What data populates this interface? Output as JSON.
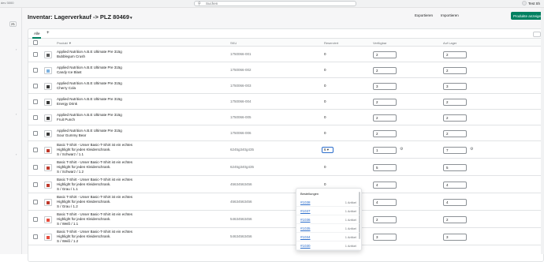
{
  "topbar": {
    "store": "dev 3000",
    "search_placeholder": "Suchen",
    "user_name": "Test Sh"
  },
  "sidebar": {
    "badge": "21"
  },
  "header": {
    "title": "Inventar: Lagerverkauf -> PLZ 80469",
    "title_chevron": "▾",
    "export_label": "Exportieren",
    "import_label": "Importieren",
    "primary_label": "Produkte anzeigen"
  },
  "tabs": {
    "all_label": "Alle",
    "add_label": "+"
  },
  "columns": {
    "product": "Produkt ▼",
    "sku": "SKU",
    "committed": "Reserviert",
    "available": "Verfügbar",
    "on_hand": "Auf Lager"
  },
  "rows": [
    {
      "name1": "Applied Nutrition A.B.E Ultimate Pre 315g",
      "name2": "Bubblegum Crush",
      "name3": "",
      "sku": "1750066-001",
      "committed": "0",
      "available": "2",
      "on_hand": "2",
      "thumb_color": "#5a5a5a"
    },
    {
      "name1": "Applied Nutrition A.B.E Ultimate Pre 315g",
      "name2": "Candy Ice Blast",
      "name3": "",
      "sku": "1750066-002",
      "committed": "0",
      "available": "2",
      "on_hand": "2",
      "thumb_color": "#7fb3e0"
    },
    {
      "name1": "Applied Nutrition A.B.E Ultimate Pre 315g",
      "name2": "Cherry Cola",
      "name3": "",
      "sku": "1750066-003",
      "committed": "0",
      "available": "3",
      "on_hand": "3",
      "thumb_color": "#3a3a3a"
    },
    {
      "name1": "Applied Nutrition A.B.E Ultimate Pre 315g",
      "name2": "Energy Drink",
      "name3": "",
      "sku": "1750066-004",
      "committed": "0",
      "available": "2",
      "on_hand": "2",
      "thumb_color": "#3a3a3a"
    },
    {
      "name1": "Applied Nutrition A.B.E Ultimate Pre 315g",
      "name2": "Fruit Punch",
      "name3": "",
      "sku": "1750066-005",
      "committed": "0",
      "available": "2",
      "on_hand": "2",
      "thumb_color": "#3a3a3a"
    },
    {
      "name1": "Applied Nutrition A.B.E Ultimate Pre 315g",
      "name2": "Sour Gummy Bear",
      "name3": "",
      "sku": "1750066-006",
      "committed": "0",
      "available": "2",
      "on_hand": "2",
      "thumb_color": "#3a3a3a"
    },
    {
      "name1": "Basic T-Shirt - Unser Basic-T-Shirt ist ein echtes",
      "name2": "Highlight für jeden Kleiderschrank.",
      "name3": "S / Schwarz / 1.1",
      "sku": "6245g340g435",
      "committed": "6",
      "available": "1",
      "on_hand": "7",
      "thumb_color": "#c0392b"
    },
    {
      "name1": "Basic T-Shirt - Unser Basic-T-Shirt ist ein echtes",
      "name2": "Highlight für jeden Kleiderschrank.",
      "name3": "S / Schwarz / 1.2",
      "sku": "6245g340g435",
      "committed": "0",
      "available": "5",
      "on_hand": "5",
      "thumb_color": "#c0392b"
    },
    {
      "name1": "Basic T-Shirt - Unser Basic-T-Shirt ist ein echtes",
      "name2": "Highlight für jeden Kleiderschrank.",
      "name3": "S / Grau / 1.1",
      "sku": "45634563456",
      "committed": "0",
      "available": "4",
      "on_hand": "4",
      "thumb_color": "#c0392b"
    },
    {
      "name1": "Basic T-Shirt - Unser Basic-T-Shirt ist ein echtes",
      "name2": "Highlight für jeden Kleiderschrank.",
      "name3": "S / Grau / 1.2",
      "sku": "45634563456",
      "committed": "0",
      "available": "4",
      "on_hand": "4",
      "thumb_color": "#c0392b"
    },
    {
      "name1": "Basic T-Shirt - Unser Basic-T-Shirt ist ein echtes",
      "name2": "Highlight für jeden Kleiderschrank.",
      "name3": "S / Weiß / 1.1",
      "sku": "54634563456",
      "committed": "0",
      "available": "2",
      "on_hand": "2",
      "thumb_color": "#e74c3c"
    },
    {
      "name1": "Basic T-Shirt - Unser Basic-T-Shirt ist ein echtes",
      "name2": "Highlight für jeden Kleiderschrank.",
      "name3": "S / Weiß / 1.2",
      "sku": "54634563456",
      "committed": "0",
      "available": "3",
      "on_hand": "3",
      "thumb_color": "#e74c3c"
    }
  ],
  "committed_dropdown": {
    "value": "6",
    "chevron": "▾"
  },
  "popover": {
    "title": "Bestellungen",
    "orders": [
      {
        "id": "#1038",
        "count": "1 Artikel"
      },
      {
        "id": "#1037",
        "count": "1 Artikel"
      },
      {
        "id": "#1036",
        "count": "1 Artikel"
      },
      {
        "id": "#1035",
        "count": "1 Artikel"
      },
      {
        "id": "#1034",
        "count": "1 Artikel"
      },
      {
        "id": "#1030",
        "count": "1 Artikel"
      }
    ]
  },
  "icons": {
    "search": "search-icon",
    "edit": "adjust-icon"
  }
}
